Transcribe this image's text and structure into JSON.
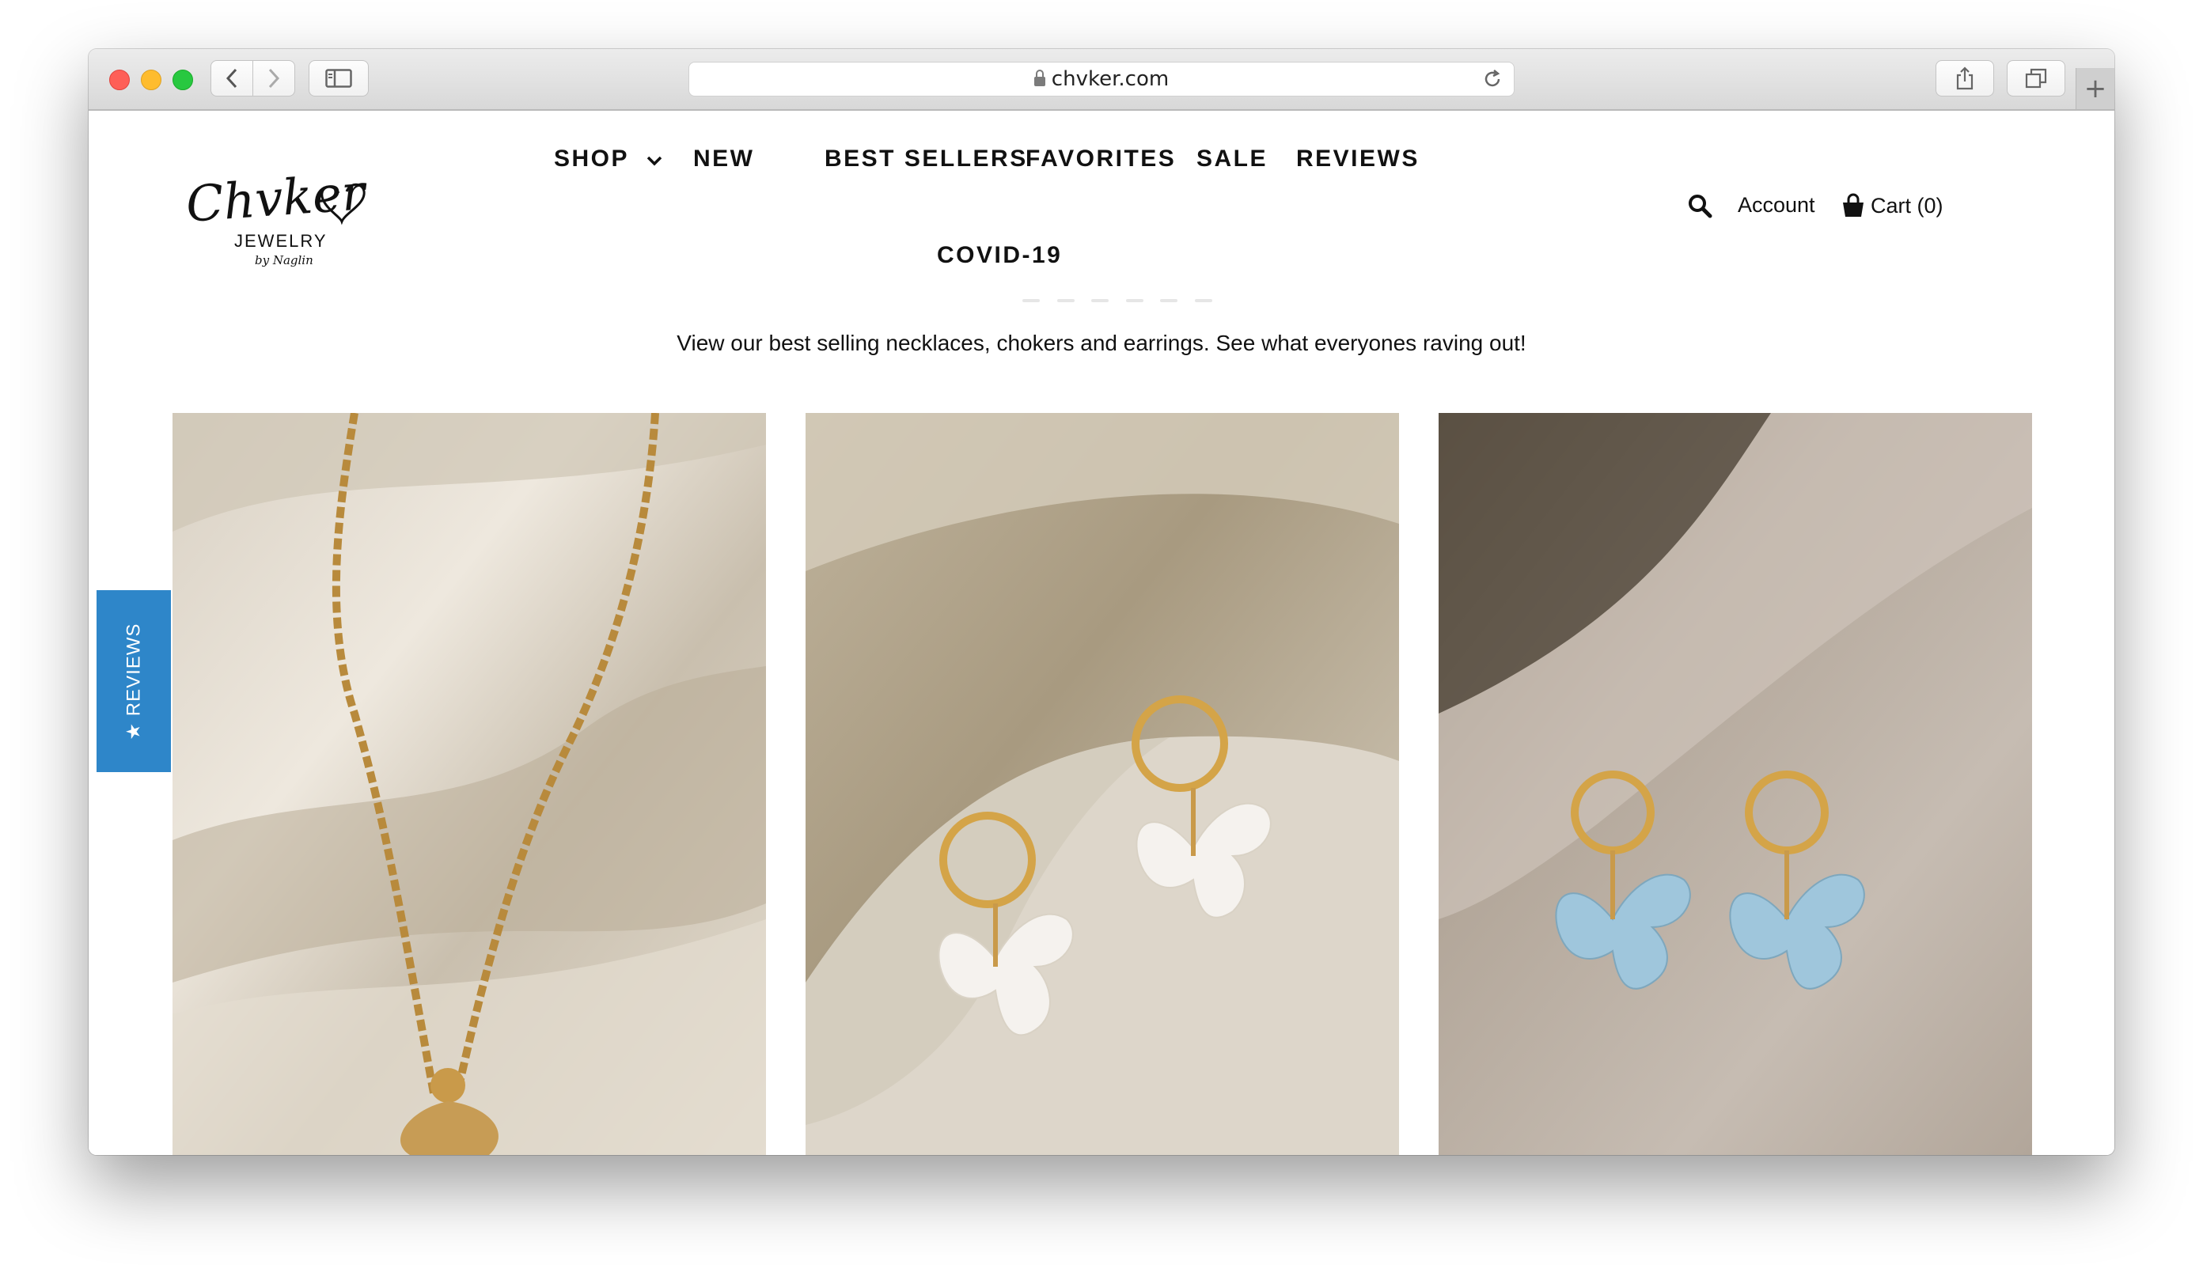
{
  "browser": {
    "url": "chvker.com"
  },
  "brand": {
    "name": "Chvker",
    "subtitle": "JEWELRY",
    "byline": "by Naglin"
  },
  "nav": {
    "items": [
      {
        "label": "SHOP",
        "has_dropdown": true
      },
      {
        "label": "NEW"
      },
      {
        "label": "BEST SELLERS"
      },
      {
        "label": "FAVORITES"
      },
      {
        "label": "SALE"
      },
      {
        "label": "REVIEWS"
      },
      {
        "label": "COVID-19"
      }
    ]
  },
  "utils": {
    "account": "Account",
    "cart": "Cart (0)"
  },
  "main": {
    "subtitle": "View our best selling necklaces, chokers and earrings. See what everyones raving out!"
  },
  "reviews_tab": {
    "label": "★ REVIEWS"
  },
  "colors": {
    "reviews_tab": "#2e86c9",
    "text": "#111111"
  }
}
